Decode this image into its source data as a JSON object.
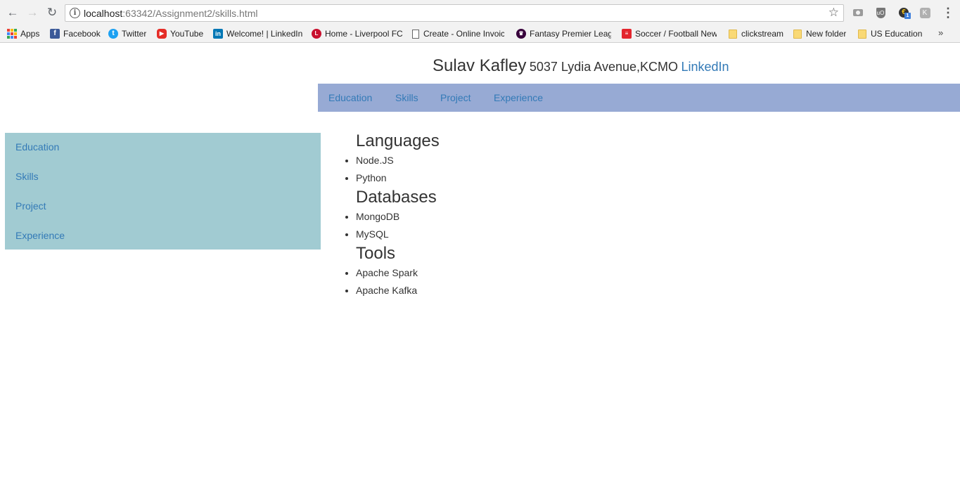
{
  "browser": {
    "url_host": "localhost",
    "url_rest": ":63342/Assignment2/skills.html",
    "extension_badge": "1",
    "bookmarks": [
      {
        "label": "Apps",
        "icon": "apps-grid-icon"
      },
      {
        "label": "Facebook",
        "icon": "facebook-icon"
      },
      {
        "label": "Twitter",
        "icon": "twitter-icon"
      },
      {
        "label": "YouTube",
        "icon": "youtube-icon"
      },
      {
        "label": "Welcome! | LinkedIn",
        "icon": "linkedin-icon"
      },
      {
        "label": "Home - Liverpool FC",
        "icon": "liverpool-icon"
      },
      {
        "label": "Create - Online Invoic",
        "icon": "document-icon"
      },
      {
        "label": "Fantasy Premier Leagu",
        "icon": "premier-league-icon"
      },
      {
        "label": "Soccer / Football New",
        "icon": "soccer-news-icon"
      },
      {
        "label": "clickstream",
        "icon": "folder-icon"
      },
      {
        "label": "New folder",
        "icon": "folder-icon"
      },
      {
        "label": "US Education",
        "icon": "folder-icon"
      }
    ],
    "more_bookmarks": "»"
  },
  "header": {
    "name": "Sulav Kafley",
    "address": "5037 Lydia Avenue,KCMO",
    "linkedin": "LinkedIn"
  },
  "top_nav": [
    "Education",
    "Skills",
    "Project",
    "Experience"
  ],
  "side_nav": [
    "Education",
    "Skills",
    "Project",
    "Experience"
  ],
  "sections": [
    {
      "title": "Languages",
      "items": [
        "Node.JS",
        "Python"
      ]
    },
    {
      "title": "Databases",
      "items": [
        "MongoDB",
        "MySQL"
      ]
    },
    {
      "title": "Tools",
      "items": [
        "Apache Spark",
        "Apache Kafka"
      ]
    }
  ],
  "colors": {
    "top_nav_bg": "#97aad4",
    "side_nav_bg": "#a1cbd2",
    "link": "#337ab7"
  }
}
